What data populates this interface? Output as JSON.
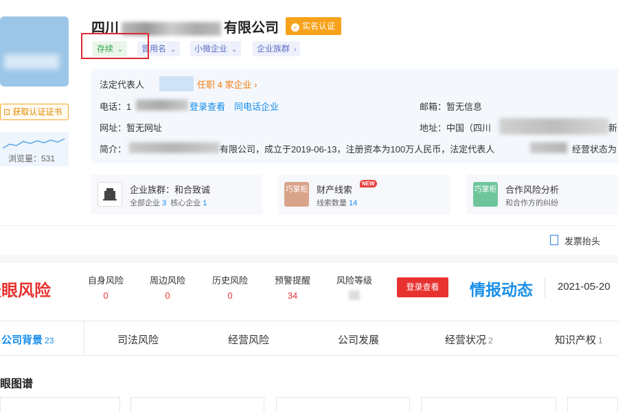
{
  "company": {
    "name_prefix": "四川",
    "name_suffix": "有限公司",
    "verified_label": "实名认证",
    "cert_button": "获取认证证书",
    "views_label": "浏览量：531"
  },
  "tags": {
    "status": "存续",
    "former_name": "曾用名",
    "size": "小微企业",
    "group": "企业族群"
  },
  "info": {
    "legal_rep_label": "法定代表人",
    "legal_rep_jobs": "任职 4 家企业 ›",
    "phone_label": "电话：1",
    "login_view": "登录查看",
    "same_phone": "同电话企业",
    "email": "邮箱：暂无信息",
    "website": "网址：暂无网址",
    "address": "地址：中国（四川",
    "address_tail": "新",
    "intro_label": "简介：",
    "intro_text": "有限公司，成立于2019-06-13，注册资本为100万人民币，法定代表人",
    "intro_tail": "经营状态为"
  },
  "cards": [
    {
      "title": "企业族群：和合致诚",
      "sub_prefix": "全部企业",
      "n1": "3",
      "sub_mid": "核心企业",
      "n2": "1"
    },
    {
      "title": "财产线索",
      "badge": "NEW",
      "sub_prefix": "线索数量",
      "n1": "14",
      "icon_text": "巧掌柜"
    },
    {
      "title": "合作风险分析",
      "sub": "和合作方的纠纷",
      "icon_text": "巧掌柜"
    }
  ],
  "invoice": "发票抬头",
  "risk": {
    "logo": "天眼风险",
    "items": [
      {
        "label": "自身风险",
        "value": "0"
      },
      {
        "label": "周边风险",
        "value": "0"
      },
      {
        "label": "历史风险",
        "value": "0"
      },
      {
        "label": "预警提醒",
        "value": "34"
      },
      {
        "label": "风险等级",
        "value": ""
      }
    ],
    "login_button": "登录查看"
  },
  "intel": {
    "logo": "情报动态",
    "date": "2021-05-20"
  },
  "tabs": [
    {
      "label": "公司背景",
      "count": "23"
    },
    {
      "label": "司法风险",
      "count": ""
    },
    {
      "label": "经营风险",
      "count": ""
    },
    {
      "label": "公司发展",
      "count": ""
    },
    {
      "label": "经营状况",
      "count": "2"
    },
    {
      "label": "知识产权",
      "count": "1"
    }
  ],
  "section_title": "天眼图谱",
  "colors": {
    "accent": "#128bed",
    "risk_red": "#e8322f",
    "badge_orange": "#f7a21b",
    "status_green": "#2fa54a"
  }
}
